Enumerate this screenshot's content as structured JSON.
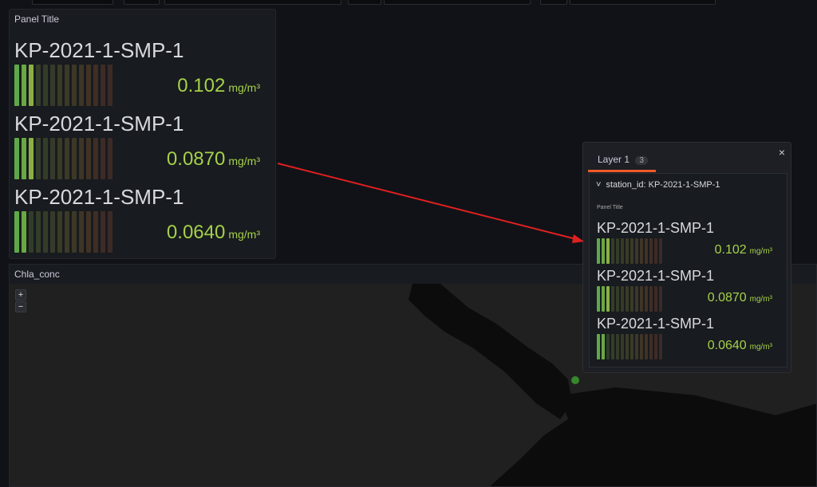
{
  "panel": {
    "title": "Panel Title",
    "items": [
      {
        "name": "KP-2021-1-SMP-1",
        "value": "0.102",
        "unit": "mg/m³",
        "lit": 3
      },
      {
        "name": "KP-2021-1-SMP-1",
        "value": "0.0870",
        "unit": "mg/m³",
        "lit": 3
      },
      {
        "name": "KP-2021-1-SMP-1",
        "value": "0.0640",
        "unit": "mg/m³",
        "lit": 2
      }
    ]
  },
  "map": {
    "title": "Chla_conc",
    "zoom_in": "+",
    "zoom_out": "−"
  },
  "popup": {
    "tab": "Layer 1",
    "count": "3",
    "close": "×",
    "group": "station_id: KP-2021-1-SMP-1",
    "chevron": "˅",
    "panel_title": "Panel Title"
  },
  "colors": {
    "value": "#a5d14a",
    "tab_underline": "#f05a28",
    "arrow": "#e02020",
    "marker": "#37872d"
  }
}
